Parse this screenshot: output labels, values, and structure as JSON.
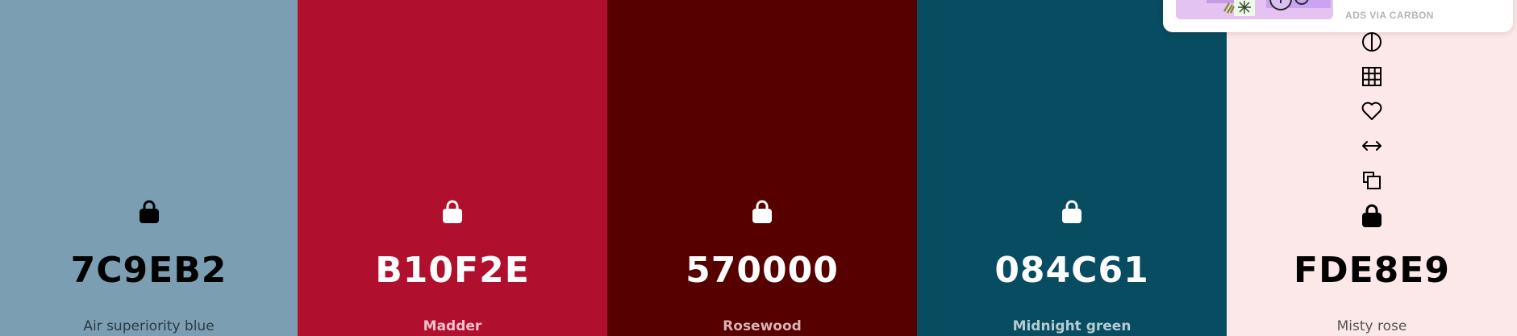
{
  "palette": [
    {
      "hex": "7C9EB2",
      "name": "Air superiority blue",
      "bg": "#7c9eb2",
      "text_color": "#000000",
      "name_color": "#2b3b44"
    },
    {
      "hex": "B10F2E",
      "name": "Madder",
      "bg": "#b10f2e",
      "text_color": "#ffffff",
      "name_color": "#f3c2cb"
    },
    {
      "hex": "570000",
      "name": "Rosewood",
      "bg": "#570000",
      "text_color": "#ffffff",
      "name_color": "#d9b3b3"
    },
    {
      "hex": "084C61",
      "name": "Midnight green",
      "bg": "#084c61",
      "text_color": "#ffffff",
      "name_color": "#b5cbd2"
    },
    {
      "hex": "FDE8E9",
      "name": "Misty rose",
      "bg": "#fde8e9",
      "text_color": "#000000",
      "name_color": "#555555"
    }
  ],
  "icons": {
    "lock": "lock-icon",
    "contrast": "contrast-icon",
    "shades": "grid-icon",
    "favorite": "heart-icon",
    "drag": "arrows-horizontal-icon",
    "copy": "copy-icon"
  },
  "ad": {
    "label": "ADS VIA CARBON"
  }
}
